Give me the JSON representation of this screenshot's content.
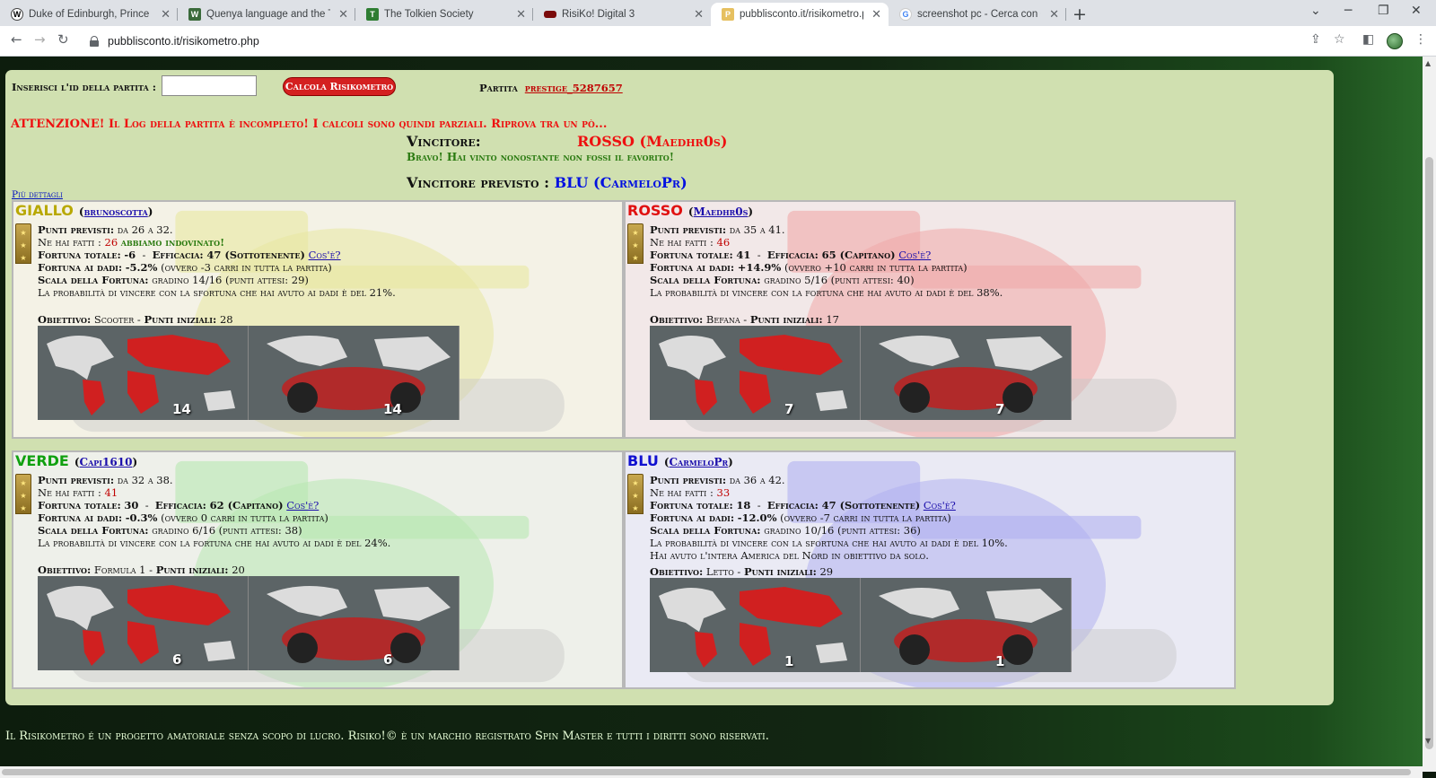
{
  "browser": {
    "tabs": [
      {
        "title": "Duke of Edinburgh, Prince Philip",
        "favicon": "wikipedia-icon"
      },
      {
        "title": "Quenya language and the Tengwar",
        "favicon": "wikiwand-icon"
      },
      {
        "title": "The Tolkien Society",
        "favicon": "tolkien-society-icon"
      },
      {
        "title": "RisiKo! Digital 3",
        "favicon": "risiko-icon"
      },
      {
        "title": "pubblisconto.it/risikometro.php",
        "favicon": "page-icon"
      },
      {
        "title": "screenshot pc - Cerca con Google",
        "favicon": "google-icon"
      }
    ],
    "url": "pubblisconto.it/risikometro.php"
  },
  "form": {
    "id_label": "Inserisci l'id della partita :",
    "button": "Calcola Risikometro",
    "partita_label": "Partita",
    "partita_link": "prestige_5287657"
  },
  "warning": "ATTENZIONE! Il Log della partita è incompleto! I calcoli sono quindi parziali. Riprova tra un pò...",
  "result": {
    "winner_label": "Vincitore:",
    "winner": "ROSSO (Maedhr0s)",
    "bravo": "Bravo! Hai vinto nonostante non fossi il favorito!",
    "predicted_label": "Vincitore previsto :",
    "predicted": "BLU (CarmeloPr)",
    "more_details": "Più dettagli"
  },
  "labels": {
    "punti_previsti": "Punti previsti:",
    "ne_hai_fatti": "Ne hai fatti :",
    "fortuna_totale": "Fortuna totale:",
    "efficacia": "Efficacia:",
    "cose": "Cos'è?",
    "fortuna_dadi": "Fortuna ai dadi:",
    "scala_fortuna": "Scala della Fortuna:",
    "obiettivo": "Obiettivo:",
    "punti_iniziali": "Punti iniziali:"
  },
  "players": [
    {
      "color_name": "GIALLO",
      "color": "#b8a800",
      "user": "brunoscotta",
      "punti_previsti": "da 26 a 32.",
      "ne_hai_fatti": "26",
      "indovinato": "abbiamo indovinato!",
      "fortuna_totale": "-6",
      "efficacia": "47 (Sottotenente)",
      "fortuna_dadi": "-5.2%",
      "fortuna_dadi_extra": "(ovvero -3 carri in tutta la partita)",
      "scala": "gradino 14/16 (punti attesi: 29)",
      "prob": "La probabilità di vincere con la sfortuna che hai avuto ai dadi è del 21%.",
      "extra": "",
      "obiettivo": "Scooter",
      "punti_iniziali": "28",
      "card_num": "14"
    },
    {
      "color_name": "ROSSO",
      "color": "#e01010",
      "user": "Maedhr0s",
      "punti_previsti": "da 35 a 41.",
      "ne_hai_fatti": "46",
      "indovinato": "",
      "fortuna_totale": "41",
      "efficacia": "65 (Capitano)",
      "fortuna_dadi": "+14.9%",
      "fortuna_dadi_extra": "(ovvero +10 carri in tutta la partita)",
      "scala": "gradino 5/16 (punti attesi: 40)",
      "prob": "La probabilità di vincere con la fortuna che hai avuto ai dadi è del 38%.",
      "extra": "",
      "obiettivo": "Befana",
      "punti_iniziali": "17",
      "card_num": "7"
    },
    {
      "color_name": "VERDE",
      "color": "#10a010",
      "user": "Capi1610",
      "punti_previsti": "da 32 a 38.",
      "ne_hai_fatti": "41",
      "indovinato": "",
      "fortuna_totale": "30",
      "efficacia": "62 (Capitano)",
      "fortuna_dadi": "-0.3%",
      "fortuna_dadi_extra": "(ovvero 0 carri in tutta la partita)",
      "scala": "gradino 6/16 (punti attesi: 38)",
      "prob": "La probabilità di vincere con la fortuna che hai avuto ai dadi è del 24%.",
      "extra": "",
      "obiettivo": "Formula 1",
      "punti_iniziali": "20",
      "card_num": "6"
    },
    {
      "color_name": "BLU",
      "color": "#1010d0",
      "user": "CarmeloPr",
      "punti_previsti": "da 36 a 42.",
      "ne_hai_fatti": "33",
      "indovinato": "",
      "fortuna_totale": "18",
      "efficacia": "47 (Sottotenente)",
      "fortuna_dadi": "-12.0%",
      "fortuna_dadi_extra": "(ovvero -7 carri in tutta la partita)",
      "scala": "gradino 10/16 (punti attesi: 36)",
      "prob": "La probabilità di vincere con la sfortuna che hai avuto ai dadi è del 10%.",
      "extra": "Hai avuto l'intera America del Nord in obiettivo da solo.",
      "obiettivo": "Letto",
      "punti_iniziali": "29",
      "card_num": "1"
    }
  ],
  "footer": "Il Risikometro é un progetto amatoriale senza scopo di lucro. Risiko!© è un marchio registrato Spin Master e tutti i diritti sono riservati."
}
